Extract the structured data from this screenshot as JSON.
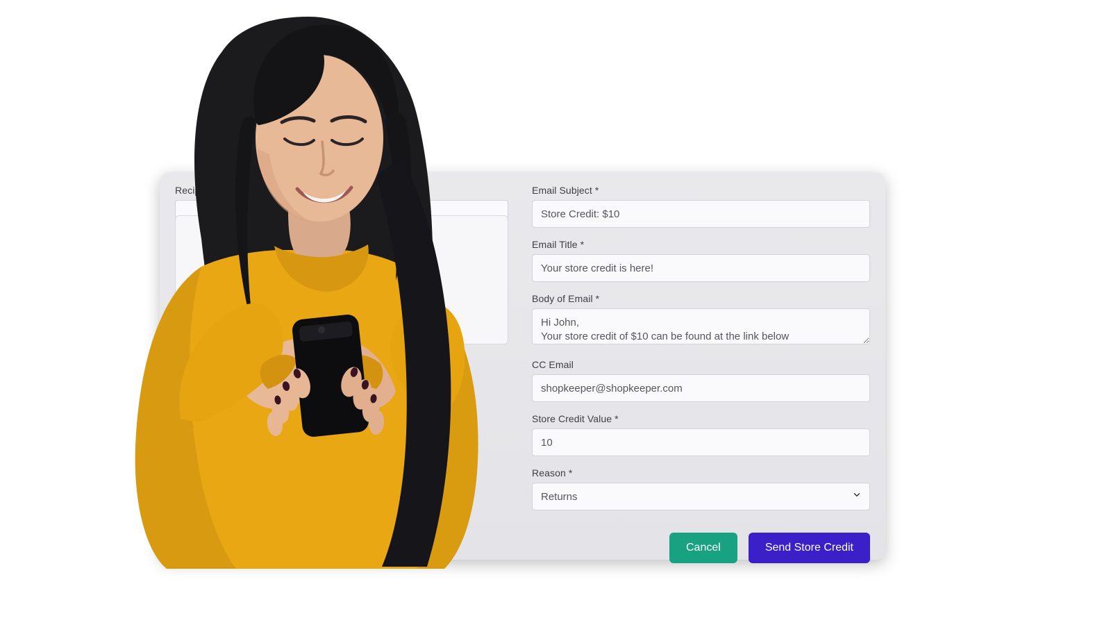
{
  "left": {
    "recipient_label": "Recipient Name"
  },
  "right": {
    "email_subject_label": "Email Subject *",
    "email_subject_value": "Store Credit: $10",
    "email_title_label": "Email Title *",
    "email_title_value": "Your store credit is here!",
    "body_label": "Body of Email *",
    "body_value": "Hi John,\nYour store credit of $10 can be found at the link below",
    "cc_label": "CC Email",
    "cc_value": "shopkeeper@shopkeeper.com",
    "store_credit_label": "Store Credit Value *",
    "store_credit_value": "10",
    "reason_label": "Reason *",
    "reason_value": "Returns"
  },
  "actions": {
    "cancel": "Cancel",
    "send": "Send Store Credit"
  },
  "colors": {
    "cancel_bg": "#19a281",
    "primary_bg": "#3b1fc8"
  }
}
